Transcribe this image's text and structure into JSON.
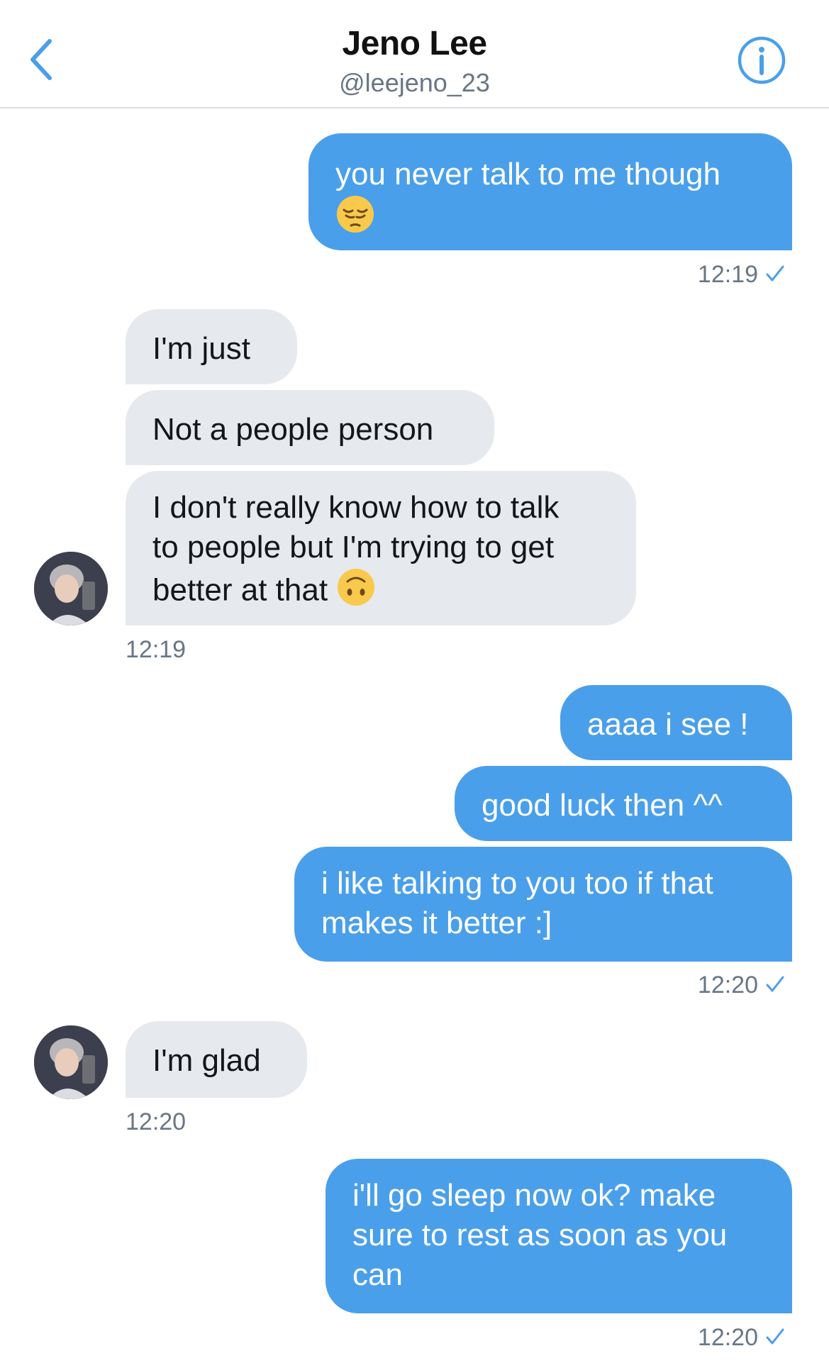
{
  "header": {
    "name": "Jeno Lee",
    "handle": "@leejeno_23",
    "back_icon": "chevron-left-icon",
    "info_icon": "info-circle-icon"
  },
  "colors": {
    "accent": "#4a9fea",
    "incoming_bubble": "#e6e9ed",
    "secondary_text": "#687684"
  },
  "messages": [
    {
      "id": "m1",
      "from": "me",
      "text": "you never talk to me though",
      "emoji": "pensive-face"
    },
    {
      "id": "t1",
      "time": "12:19",
      "read": true
    },
    {
      "id": "m2",
      "from": "them",
      "text": "I'm just"
    },
    {
      "id": "m3",
      "from": "them",
      "text": "Not a people person"
    },
    {
      "id": "m4",
      "from": "them",
      "text_lines": [
        "I don't really know how to talk",
        "to people but I'm trying to get",
        "better at that"
      ],
      "emoji": "upside-down-face"
    },
    {
      "id": "t2",
      "time": "12:19"
    },
    {
      "id": "m5",
      "from": "me",
      "text": "aaaa i see !"
    },
    {
      "id": "m6",
      "from": "me",
      "text": "good luck then ^^"
    },
    {
      "id": "m7",
      "from": "me",
      "text_lines": [
        "i like talking to you too if that",
        "makes it better :]"
      ]
    },
    {
      "id": "t3",
      "time": "12:20",
      "read": true
    },
    {
      "id": "m8",
      "from": "them",
      "text": "I'm glad"
    },
    {
      "id": "t4",
      "time": "12:20"
    },
    {
      "id": "m9",
      "from": "me",
      "text_lines": [
        "i'll go sleep now ok? make",
        "sure to rest as soon as you",
        "can"
      ]
    },
    {
      "id": "t5",
      "time": "12:20",
      "read": true
    }
  ]
}
